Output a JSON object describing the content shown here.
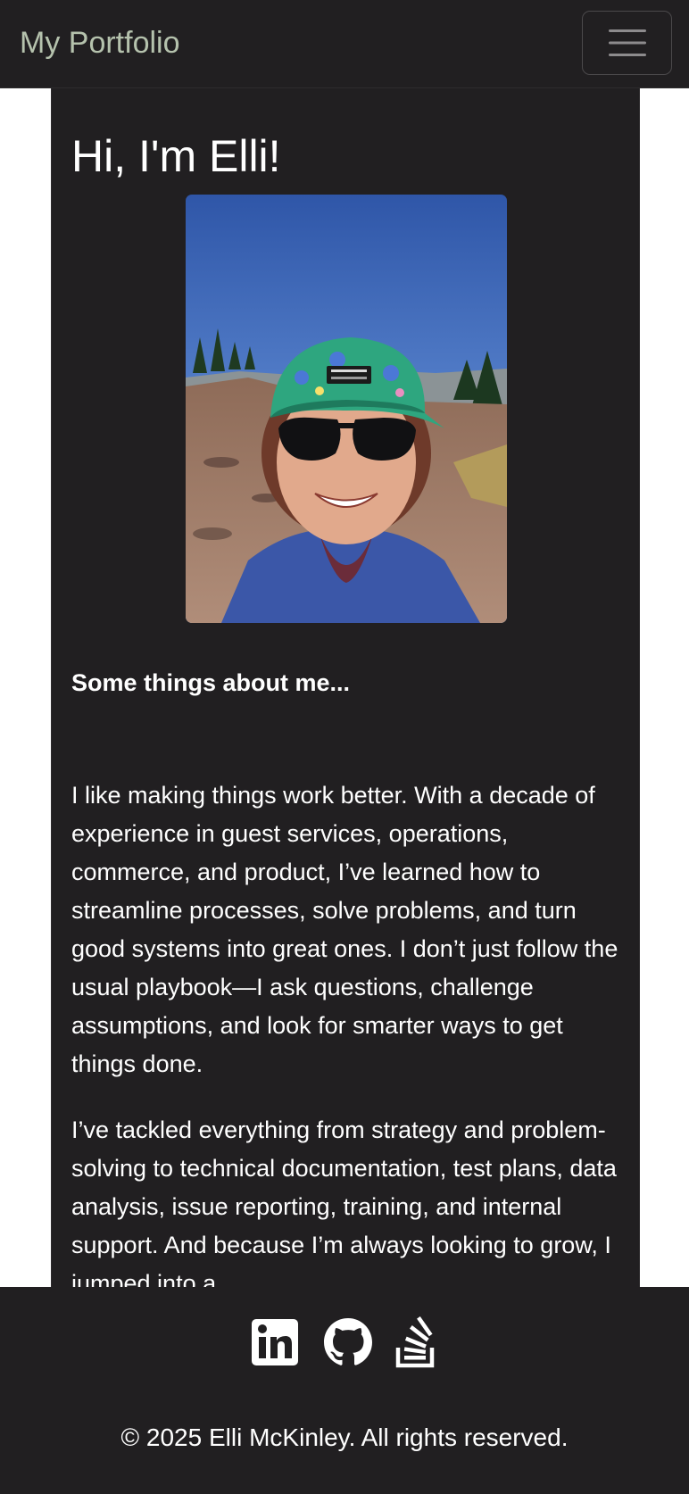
{
  "navbar": {
    "brand": "My Portfolio",
    "toggle_icon": "hamburger-menu-icon",
    "brand_color": "#b5c2ad",
    "background": "#211f21"
  },
  "main": {
    "heading": "Hi, I'm Elli!",
    "photo": "profile-photo",
    "subheading": "Some things about me...",
    "paragraphs": [
      "I like making things work better. With a decade of experience in guest services, operations, commerce, and product, I’ve learned how to streamline processes, solve problems, and turn good systems into great ones. I don’t just follow the usual playbook—I ask questions, challenge assumptions, and look for smarter ways to get things done.",
      "I’ve tackled everything from strategy and problem-solving to technical documentation, test plans, data analysis, issue reporting, training, and internal support. And because I’m always looking to grow, I jumped into a"
    ]
  },
  "footer": {
    "social_icons": [
      "linkedin-icon",
      "github-icon",
      "stackoverflow-icon"
    ],
    "copyright": "© 2025 Elli McKinley. All rights reserved."
  }
}
